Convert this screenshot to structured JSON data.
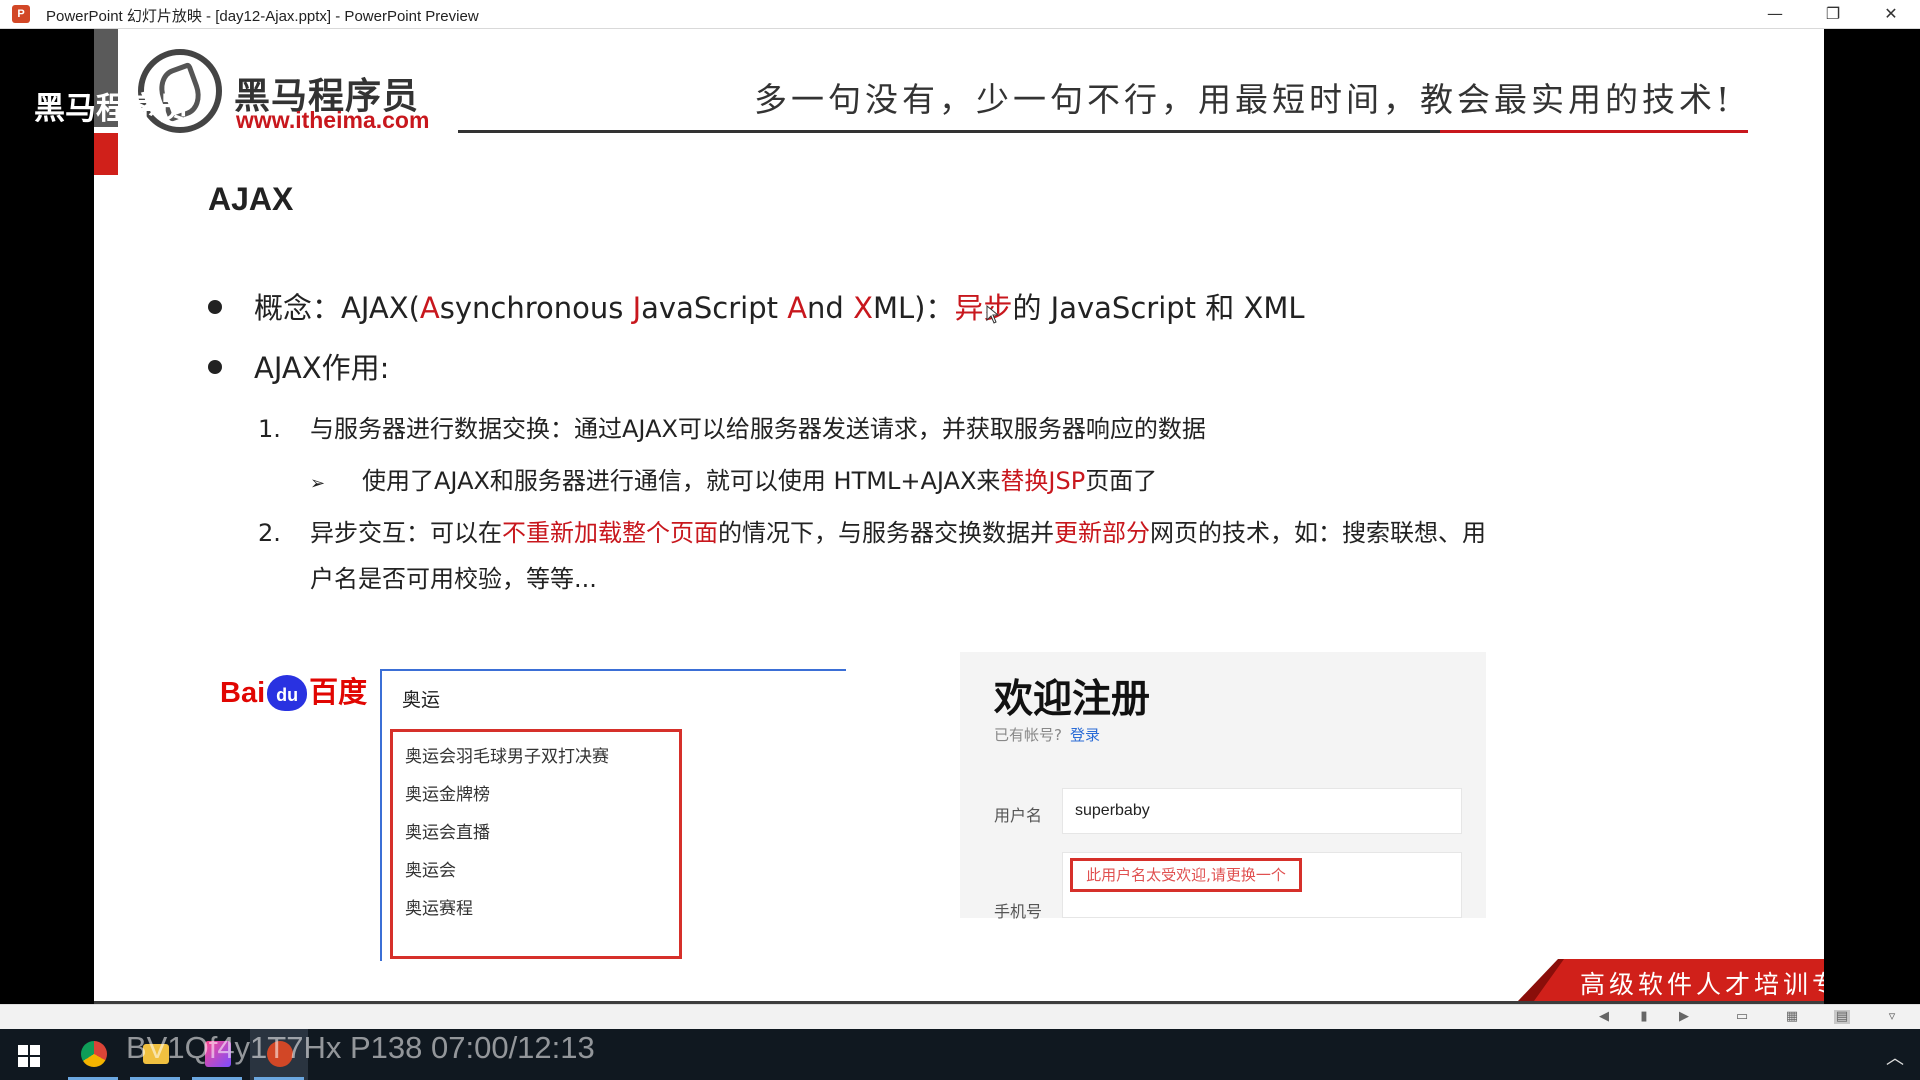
{
  "window": {
    "title": "PowerPoint 幻灯片放映 - [day12-Ajax.pptx] - PowerPoint Preview",
    "app_icon": "P",
    "buttons": {
      "minimize": "—",
      "restore": "❐",
      "close": "✕"
    }
  },
  "slide": {
    "logo": {
      "name": "黑马程序员",
      "url": "www.itheima.com"
    },
    "watermark": "黑马程序员",
    "slogan": "多一句没有，少一句不行，用最短时间，教会最实用的技术!",
    "title": "AJAX",
    "bullet1": {
      "prefix": "概念：AJAX(",
      "a": "A",
      "t1": "synchronous ",
      "j": "J",
      "t2": "avaScript ",
      "a2": "A",
      "t3": "nd ",
      "x": "X",
      "t4": "ML)：",
      "async": "异步",
      "suffix": "的 JavaScript 和 XML"
    },
    "bullet2": "AJAX作用:",
    "item1": {
      "num": "1.",
      "text": "与服务器进行数据交换：通过AJAX可以给服务器发送请求，并获取服务器响应的数据"
    },
    "sub1": {
      "arrow": "➢",
      "pre": "使用了AJAX和服务器进行通信，就可以使用 HTML+AJAX来",
      "red": "替换JSP",
      "post": "页面了"
    },
    "item2": {
      "num": "2.",
      "p1": "异步交互：可以在",
      "r1": "不重新加载整个页面",
      "p2": "的情况下，与服务器交换数据并",
      "r2": "更新部分",
      "p3": "网页的技术，如：搜索联想、用",
      "line2": "户名是否可用校验，等等..."
    },
    "baidu": {
      "logo_bai": "Bai",
      "logo_paw": "du",
      "logo_du": "百度",
      "query": "奥运",
      "suggestions": [
        "奥运会羽毛球男子双打决赛",
        "奥运金牌榜",
        "奥运会直播",
        "奥运会",
        "奥运赛程"
      ]
    },
    "register": {
      "title": "欢迎注册",
      "hint": "已有帐号?",
      "login": "登录",
      "user_label": "用户名",
      "user_value": "superbaby",
      "error": "此用户名太受欢迎,请更换一个",
      "phone_label": "手机号"
    },
    "corner_banner": "高级软件人才培训专家"
  },
  "taskbar": {
    "overlay": "BV1Qf4y1T7Hx P138 07:00/12:13"
  },
  "colors": {
    "accent_red": "#c8171d",
    "taskbar": "#101820",
    "link_blue": "#2b6cd6"
  }
}
